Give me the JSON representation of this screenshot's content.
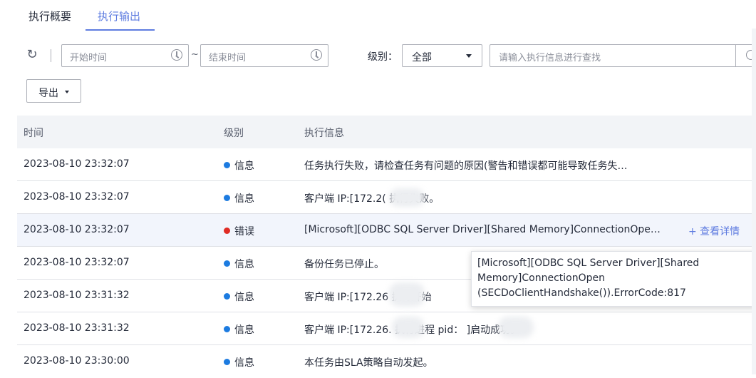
{
  "tabs": [
    {
      "label": "执行概要"
    },
    {
      "label": "执行输出"
    }
  ],
  "filters": {
    "start_placeholder": "开始时间",
    "end_placeholder": "结束时间",
    "tilde": "~",
    "level_label": "级别：",
    "level_value": "全部",
    "search_placeholder": "请输入执行信息进行查找",
    "export_label": "导出"
  },
  "icons": {
    "refresh": "refresh-icon",
    "clock": "clock-icon",
    "search": "search-icon",
    "caret": "caret-down-icon"
  },
  "colors": {
    "accent": "#5e7ce0",
    "info": "#1c7be0",
    "error": "#e02b24"
  },
  "table": {
    "headers": [
      "时间",
      "级别",
      "执行信息"
    ],
    "rows": [
      {
        "time": "2023-08-10 23:32:07",
        "level": "信息",
        "level_type": "info",
        "message": "任务执行失败，请检查任务有问题的原因(警告和错误都可能导致任务失…"
      },
      {
        "time": "2023-08-10 23:32:07",
        "level": "信息",
        "level_type": "info",
        "message": "客户端 IP:[172.2(         执行失败。"
      },
      {
        "time": "2023-08-10 23:32:07",
        "level": "错误",
        "level_type": "error",
        "message": "[Microsoft][ODBC SQL Server Driver][Shared Memory]ConnectionOpe…",
        "action": "+ 查看详情"
      },
      {
        "time": "2023-08-10 23:32:07",
        "level": "信息",
        "level_type": "info",
        "message": "备份任务已停止。"
      },
      {
        "time": "2023-08-10 23:31:32",
        "level": "信息",
        "level_type": "info",
        "message": "客户端 IP:[172.26          执行开始"
      },
      {
        "time": "2023-08-10 23:31:32",
        "level": "信息",
        "level_type": "info",
        "message": "客户端 IP:[172.26.          执行进程 pid：          ]启动成功。"
      },
      {
        "time": "2023-08-10 23:30:00",
        "level": "信息",
        "level_type": "info",
        "message": "本任务由SLA策略自动发起。"
      }
    ]
  },
  "tooltip": {
    "line1": "[Microsoft][ODBC SQL Server Driver][Shared",
    "line2": "Memory]ConnectionOpen",
    "line3": "(SECDoClientHandshake()).ErrorCode:817"
  }
}
